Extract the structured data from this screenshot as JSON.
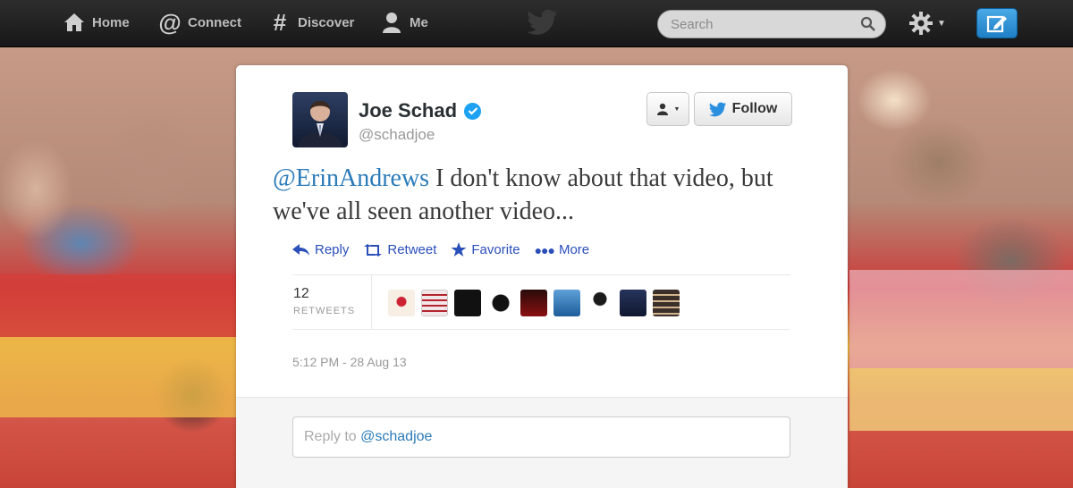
{
  "topbar": {
    "nav": [
      {
        "label": "Home",
        "icon": "home-icon"
      },
      {
        "label": "Connect",
        "icon": "at-icon"
      },
      {
        "label": "Discover",
        "icon": "hash-icon"
      },
      {
        "label": "Me",
        "icon": "person-icon"
      }
    ],
    "search": {
      "placeholder": "Search"
    }
  },
  "tweet": {
    "author_name": "Joe Schad",
    "handle": "@schadjoe",
    "mention": "@ErinAndrews",
    "text": " I don't know about that video, but we've all seen another video...",
    "follow_label": "Follow",
    "actions": [
      "Reply",
      "Retweet",
      "Favorite",
      "More"
    ],
    "retweet_count": "12",
    "retweet_label": "RETWEETS",
    "timestamp": "5:12 PM - 28 Aug 13",
    "reply_prefix": "Reply to ",
    "reply_handle": "@schadjoe"
  },
  "colors": {
    "link": "#2b7bb9",
    "action": "#2b4fb9",
    "verified": "#1da1f2",
    "compose": "#2a8fd6"
  }
}
